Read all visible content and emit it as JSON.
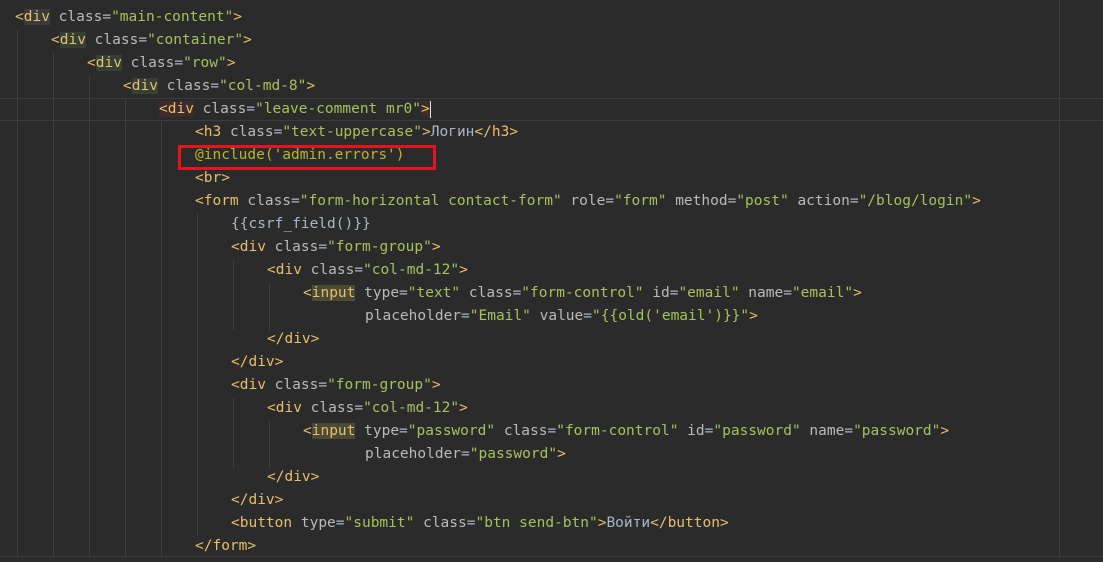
{
  "lines": [
    {
      "tag": "div",
      "attrs": [
        [
          "class",
          "main-content"
        ]
      ]
    },
    {
      "tag": "div",
      "attrs": [
        [
          "class",
          "container"
        ]
      ]
    },
    {
      "tag": "div",
      "attrs": [
        [
          "class",
          "row"
        ]
      ]
    },
    {
      "tag": "div",
      "attrs": [
        [
          "class",
          "col-md-8"
        ]
      ]
    },
    {
      "tag": "div",
      "attrs": [
        [
          "class",
          "leave-comment mr0"
        ]
      ]
    },
    {
      "tag": "h3",
      "attrs": [
        [
          "class",
          "text-uppercase"
        ]
      ],
      "text": "Логин",
      "close": "h3"
    },
    {
      "directive": "@include('admin.errors')"
    },
    {
      "tag": "br"
    },
    {
      "tag": "form",
      "attrs": [
        [
          "class",
          "form-horizontal contact-form"
        ],
        [
          "role",
          "form"
        ],
        [
          "method",
          "post"
        ],
        [
          "action",
          "/blog/login"
        ]
      ]
    },
    {
      "text": "{{csrf_field()}}"
    },
    {
      "tag": "div",
      "attrs": [
        [
          "class",
          "form-group"
        ]
      ]
    },
    {
      "tag": "div",
      "attrs": [
        [
          "class",
          "col-md-12"
        ]
      ]
    },
    {
      "tag": "input",
      "attrs": [
        [
          "type",
          "text"
        ],
        [
          "class",
          "form-control"
        ],
        [
          "id",
          "email"
        ],
        [
          "name",
          "email"
        ]
      ]
    },
    {
      "attrs": [
        [
          "placeholder",
          "Email"
        ],
        [
          "value",
          "{{old('email')}}"
        ]
      ]
    },
    {
      "close": "div"
    },
    {
      "close": "div"
    },
    {
      "tag": "div",
      "attrs": [
        [
          "class",
          "form-group"
        ]
      ]
    },
    {
      "tag": "div",
      "attrs": [
        [
          "class",
          "col-md-12"
        ]
      ]
    },
    {
      "tag": "input",
      "attrs": [
        [
          "type",
          "password"
        ],
        [
          "class",
          "form-control"
        ],
        [
          "id",
          "password"
        ],
        [
          "name",
          "password"
        ]
      ]
    },
    {
      "attrs": [
        [
          "placeholder",
          "password"
        ]
      ]
    },
    {
      "close": "div"
    },
    {
      "close": "div"
    },
    {
      "tag": "button",
      "attrs": [
        [
          "type",
          "submit"
        ],
        [
          "class",
          "btn send-btn"
        ]
      ],
      "text": "Войти",
      "close": "button"
    },
    {
      "close": "form"
    }
  ],
  "theme": {
    "background": "#2b2b2b",
    "tag": "#e8bf6a",
    "attribute": "#bababa",
    "string": "#a5c25c",
    "text": "#a9b7c6",
    "directive": "#bbb529",
    "highlight_box": "#e4151c"
  }
}
